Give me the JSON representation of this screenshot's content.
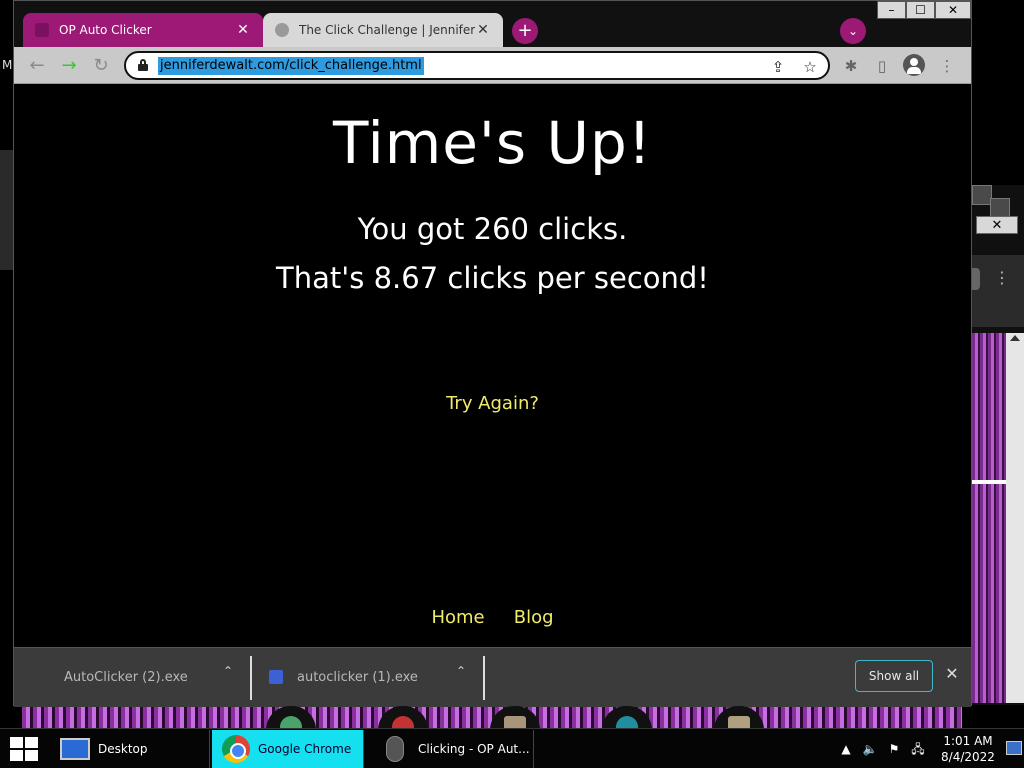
{
  "browser": {
    "tabs": [
      {
        "title": "OP Auto Clicker",
        "close": "✕"
      },
      {
        "title": "The Click Challenge | Jennifer De",
        "close": "✕"
      }
    ],
    "new_tab": "+",
    "tab_search": "⌄",
    "url": "jenniferdewalt.com/click_challenge.html",
    "window_controls": {
      "minimize": "–",
      "maximize": "☐",
      "close": "✕"
    }
  },
  "page": {
    "headline": "Time's Up!",
    "result_line1": "You got 260 clicks.",
    "result_line2": "That's 8.67 clicks per second!",
    "try_again": "Try Again?",
    "footer": {
      "home": "Home",
      "blog": "Blog"
    }
  },
  "downloads": {
    "items": [
      {
        "name": "AutoClicker (2).exe"
      },
      {
        "name": "autoclicker (1).exe"
      }
    ],
    "show_all": "Show all",
    "close": "✕"
  },
  "background": {
    "left_letter": "M",
    "right_close": "✕",
    "right_menu": "⋮"
  },
  "taskbar": {
    "desktop": "Desktop",
    "chrome": "Google Chrome",
    "clicking": "Clicking - OP Aut...",
    "time": "1:01 AM",
    "date": "8/4/2022",
    "tray_arrow": "▲"
  },
  "colors": {
    "tab_accent": "#9c1a76",
    "link_yellow": "#f0ec6a",
    "url_highlight": "#2e9be0",
    "taskbar_active": "#15e0f0"
  }
}
